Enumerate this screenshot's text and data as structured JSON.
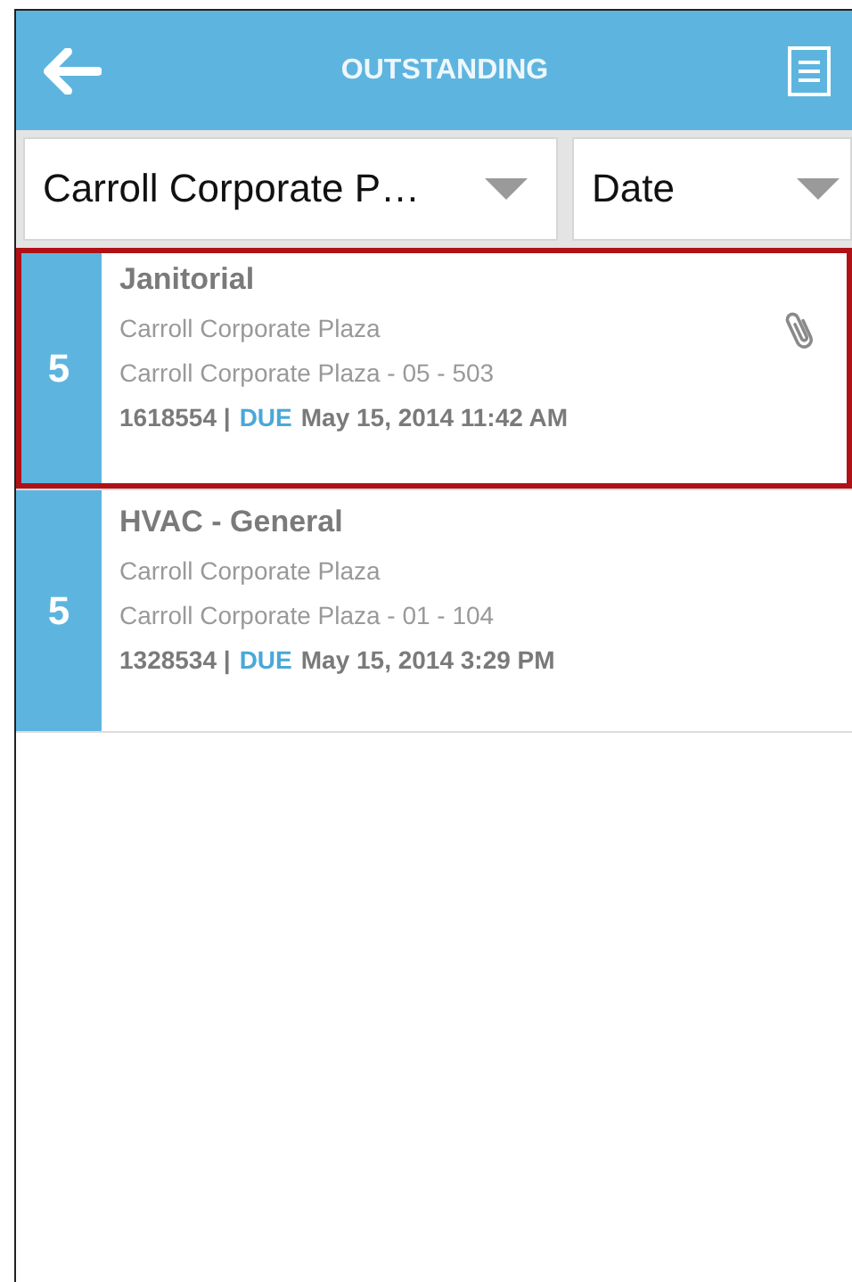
{
  "header": {
    "title": "OUTSTANDING"
  },
  "filters": [
    {
      "value": "Carroll Corporate P…"
    },
    {
      "value": "Date"
    }
  ],
  "work_orders": [
    {
      "priority": "5",
      "title": "Janitorial",
      "site": "Carroll Corporate Plaza",
      "location": "Carroll Corporate Plaza - 05 - 503",
      "ref": "1618554 |",
      "due_label": "DUE",
      "due": "May 15, 2014 11:42 AM",
      "attachment": true,
      "selected": true
    },
    {
      "priority": "5",
      "title": "HVAC - General",
      "site": "Carroll Corporate Plaza",
      "location": "Carroll Corporate Plaza - 01 - 104",
      "ref": "1328534 |",
      "due_label": "DUE",
      "due": "May 15, 2014 3:29 PM",
      "attachment": false,
      "selected": false
    }
  ]
}
